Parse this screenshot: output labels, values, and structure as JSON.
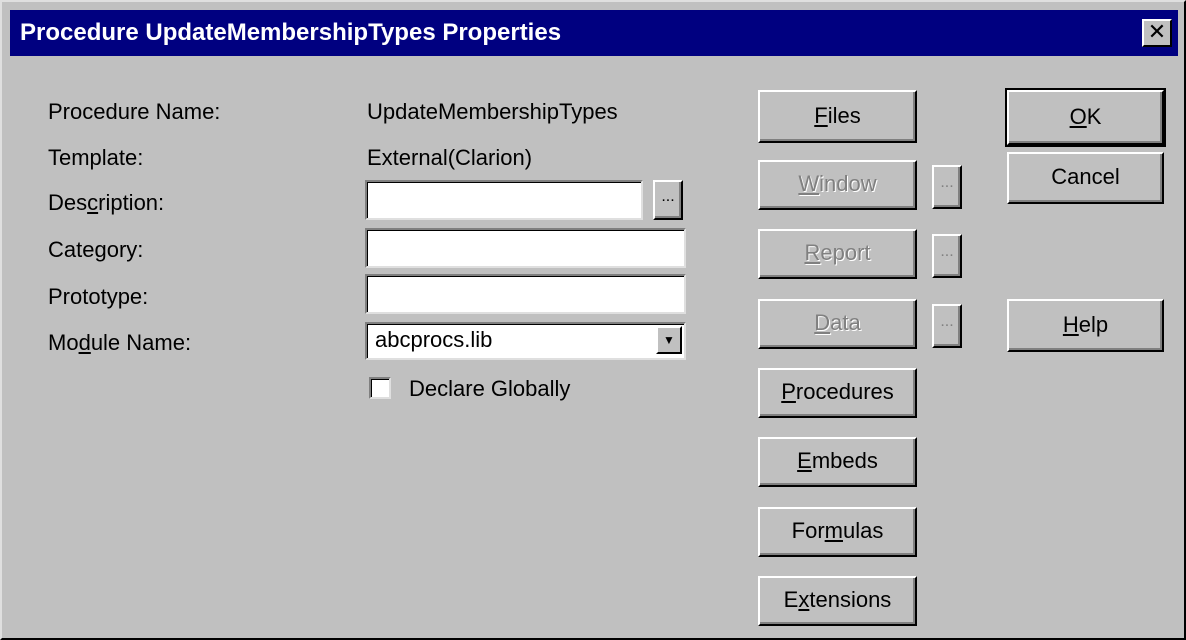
{
  "window": {
    "title": "Procedure UpdateMembershipTypes Properties",
    "close_glyph": "✕"
  },
  "fields": {
    "procedure_name": {
      "label": "Procedure Name:",
      "value": "UpdateMembershipTypes"
    },
    "template": {
      "label": "Template:",
      "value": "External(Clarion)"
    },
    "description": {
      "label_pre": "Des",
      "label_hot": "c",
      "label_post": "ription:",
      "value": ""
    },
    "category": {
      "label": "Category:",
      "value": ""
    },
    "prototype": {
      "label": "Prototype:",
      "value": ""
    },
    "module_name": {
      "label_pre": "Mo",
      "label_hot": "d",
      "label_post": "ule Name:",
      "value": "abcprocs.lib"
    },
    "declare_globally": {
      "label": "Declare Globally",
      "checked": false
    }
  },
  "ellipsis_label": "...",
  "buttons": {
    "files": {
      "hot": "F",
      "rest": "iles",
      "enabled": true
    },
    "window": {
      "hot": "W",
      "rest": "indow",
      "enabled": false
    },
    "report": {
      "hot": "R",
      "rest": "eport",
      "enabled": false
    },
    "data": {
      "hot": "D",
      "rest": "ata",
      "enabled": false
    },
    "procedures": {
      "hot": "P",
      "rest": "rocedures",
      "enabled": true
    },
    "embeds": {
      "hot": "E",
      "rest": "mbeds",
      "enabled": true
    },
    "formulas": {
      "pre": "For",
      "hot": "m",
      "rest": "ulas",
      "enabled": true
    },
    "extensions": {
      "pre": "E",
      "hot": "x",
      "rest": "tensions",
      "enabled": true
    },
    "ok": {
      "hot": "O",
      "rest": "K"
    },
    "cancel": {
      "label": "Cancel"
    },
    "help": {
      "hot": "H",
      "rest": "elp"
    }
  },
  "colors": {
    "titlebar": "#000080",
    "face": "#c0c0c0",
    "disabled_text": "#808080"
  }
}
